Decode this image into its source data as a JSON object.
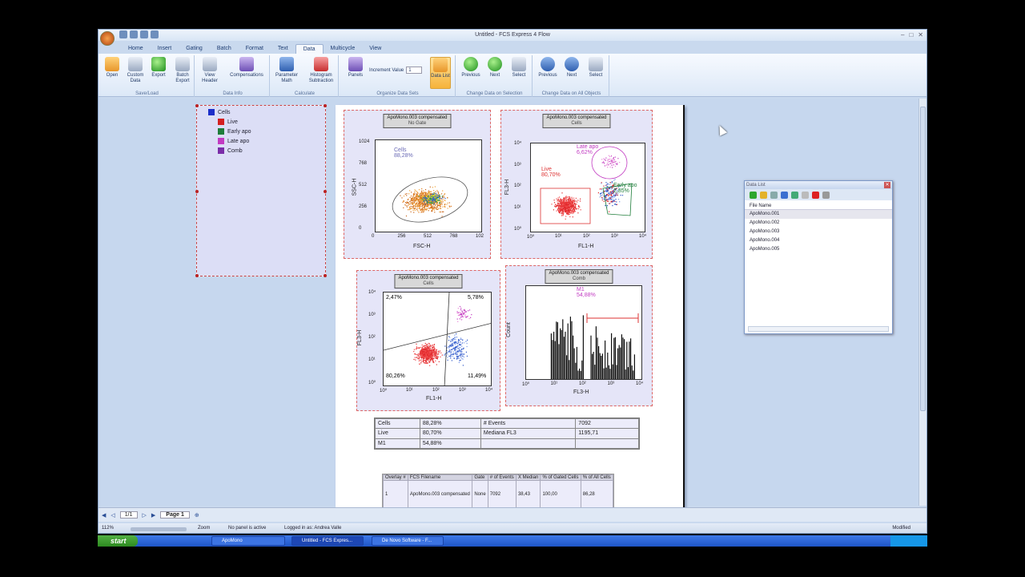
{
  "window": {
    "title": "Untitled - FCS Express 4 Flow"
  },
  "tabs": [
    "Home",
    "Insert",
    "Gating",
    "Batch",
    "Format",
    "Text",
    "Data",
    "Multicycle",
    "View"
  ],
  "active_tab": "Data",
  "ribbon": {
    "groups": [
      {
        "label": "Save/Load",
        "buttons": [
          "Open",
          "Custom Data",
          "Export",
          "Batch Export"
        ]
      },
      {
        "label": "Data Info",
        "buttons": [
          "View Header",
          "Compensations"
        ]
      },
      {
        "label": "Calculate",
        "buttons": [
          "Parameter Math",
          "Histogram Subtraction"
        ]
      },
      {
        "label": "Organize Data Sets",
        "buttons": [
          "Panels",
          "Data List"
        ]
      },
      {
        "label": "Change Data on Selection",
        "buttons": [
          "Previous",
          "Next",
          "Select"
        ]
      },
      {
        "label": "Change Data on All Objects",
        "buttons": [
          "Previous",
          "Next",
          "Select"
        ]
      }
    ],
    "increment_label": "Increment Value",
    "increment_value": "1"
  },
  "gate_tree": {
    "root": "Cells",
    "items": [
      {
        "label": "Live",
        "color": "#d42020"
      },
      {
        "label": "Early apo",
        "color": "#1f7d3a"
      },
      {
        "label": "Late apo",
        "color": "#c23bc2"
      },
      {
        "label": "Comb",
        "color": "#7a2da8"
      }
    ],
    "root_color": "#1c2fc9"
  },
  "plots": {
    "p1": {
      "title": "ApoMono.003 compensated",
      "subtitle": "No Gate",
      "xlabel": "FSC-H",
      "ylabel": "SSC-H",
      "xticks": [
        "0",
        "256",
        "512",
        "768",
        "102"
      ],
      "yticks": [
        "1024",
        "768",
        "512",
        "256",
        "0"
      ],
      "gate_label": "Cells",
      "gate_pct": "88,28%"
    },
    "p2": {
      "title": "ApoMono.003 compensated",
      "subtitle": "Cells",
      "xlabel": "FL1-H",
      "ylabel": "FL3-H",
      "xticks": [
        "10⁰",
        "10¹",
        "10²",
        "10³",
        "10⁴"
      ],
      "yticks": [
        "10⁴",
        "10³",
        "10²",
        "10¹",
        "10⁰"
      ],
      "g_late": "Late apo",
      "g_late_pct": "6,62%",
      "g_live": "Live",
      "g_live_pct": "80,70%",
      "g_early": "Early apo",
      "g_early_pct": "2,85%"
    },
    "p3": {
      "title": "ApoMono.003 compensated",
      "subtitle": "Cells",
      "xlabel": "FL1-H",
      "ylabel": "FL3-H",
      "xticks": [
        "10⁰",
        "10¹",
        "10²",
        "10³",
        "10⁴"
      ],
      "yticks": [
        "10⁴",
        "10³",
        "10²",
        "10¹",
        "10⁰"
      ],
      "q_ul": "2,47%",
      "q_ur": "5,78%",
      "q_ll": "80,26%",
      "q_lr": "11,49%"
    },
    "p4": {
      "title": "ApoMono.003 compensated",
      "subtitle": "Comb",
      "xlabel": "FL3-H",
      "ylabel": "Count",
      "xticks": [
        "10⁰",
        "10¹",
        "10²",
        "10³",
        "10⁴"
      ],
      "marker": "M1",
      "marker_pct": "54,88%"
    }
  },
  "stats": {
    "rows": [
      [
        "Cells",
        "88,28%",
        "# Events",
        "7092"
      ],
      [
        "Live",
        "80,70%",
        "Mediana FL3",
        "1195,71"
      ],
      [
        "M1",
        "54,88%",
        "",
        ""
      ]
    ]
  },
  "table2": {
    "headers": [
      "Overlay #",
      "FCS Filename",
      "Gate",
      "# of Events",
      "X Median",
      "% of Gated Cells",
      "% of All Cells"
    ],
    "row": [
      "1",
      "ApoMono.003 compensated",
      "None",
      "7092",
      "38,43",
      "100,00",
      "86,28"
    ]
  },
  "data_list": {
    "title": "Data List",
    "column": "File Name",
    "files": [
      "ApoMono.001",
      "ApoMono.002",
      "ApoMono.003",
      "ApoMono.004",
      "ApoMono.005"
    ]
  },
  "pagebar": {
    "page_count": "1/1",
    "page_tab": "Page 1"
  },
  "status": {
    "zoom_pct": "112%",
    "zoom_label": "Zoom",
    "panel": "No panel is active",
    "user": "Logged in as: Andrea Valle",
    "modified": "Modified"
  },
  "taskbar": {
    "start": "start",
    "tasks": [
      "ApoMono",
      "Untitled - FCS Expres...",
      "De Novo Software - F..."
    ]
  }
}
